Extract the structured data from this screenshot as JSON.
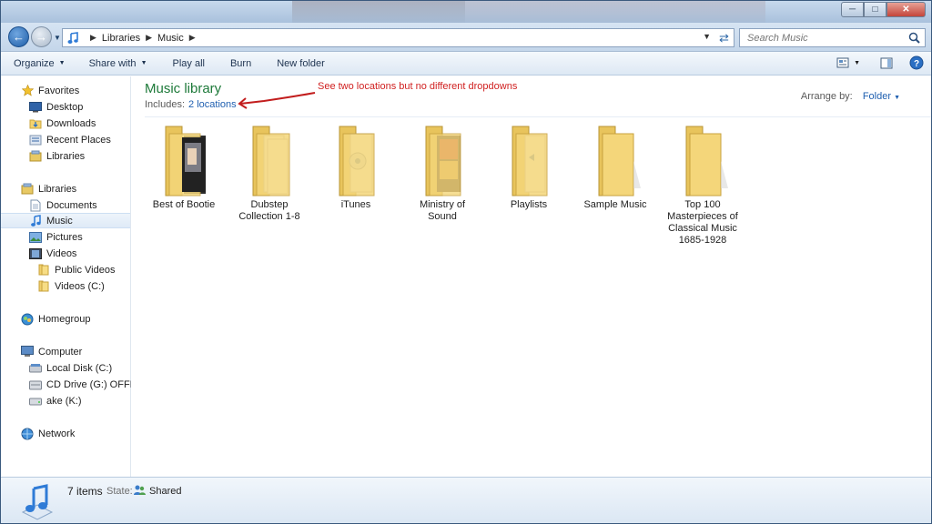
{
  "titlebar": {
    "minimize_icon": "minimize-icon",
    "maximize_icon": "maximize-icon",
    "close_icon": "close-icon"
  },
  "address": {
    "breadcrumbs": [
      "Libraries",
      "Music"
    ]
  },
  "search": {
    "placeholder": "Search Music"
  },
  "toolbar": {
    "organize": "Organize",
    "share_with": "Share with",
    "play_all": "Play all",
    "burn": "Burn",
    "new_folder": "New folder"
  },
  "sidebar": {
    "favorites": {
      "label": "Favorites",
      "items": [
        "Desktop",
        "Downloads",
        "Recent Places",
        "Libraries"
      ]
    },
    "libraries": {
      "label": "Libraries",
      "items": [
        "Documents",
        "Music",
        "Pictures",
        "Videos"
      ],
      "video_children": [
        "Public Videos",
        "Videos (C:)"
      ]
    },
    "homegroup": "Homegroup",
    "computer": {
      "label": "Computer",
      "items": [
        "Local Disk (C:)",
        "CD Drive (G:) OFFICE",
        "ake (K:)"
      ]
    },
    "network": "Network"
  },
  "library": {
    "title": "Music library",
    "includes_label": "Includes:",
    "includes_link": "2 locations",
    "annotation": "See two locations but no different dropdowns",
    "arrange_label": "Arrange by:",
    "arrange_value": "Folder"
  },
  "folders": [
    {
      "line1": "Best of Bootie",
      "line2": "",
      "line3": "",
      "line4": ""
    },
    {
      "line1": "Dubstep",
      "line2": "Collection 1-8",
      "line3": "",
      "line4": ""
    },
    {
      "line1": "iTunes",
      "line2": "",
      "line3": "",
      "line4": ""
    },
    {
      "line1": "Ministry of",
      "line2": "Sound",
      "line3": "",
      "line4": ""
    },
    {
      "line1": "Playlists",
      "line2": "",
      "line3": "",
      "line4": ""
    },
    {
      "line1": "Sample Music",
      "line2": "",
      "line3": "",
      "line4": ""
    },
    {
      "line1": "Top 100",
      "line2": "Masterpieces of",
      "line3": "Classical Music",
      "line4": "1685-1928"
    }
  ],
  "status": {
    "items": "7 items",
    "state_label": "State:",
    "state_value": "Shared"
  },
  "colors": {
    "library_title": "#1e7a3a",
    "link": "#1f5fb0",
    "annotation": "#d02020"
  }
}
